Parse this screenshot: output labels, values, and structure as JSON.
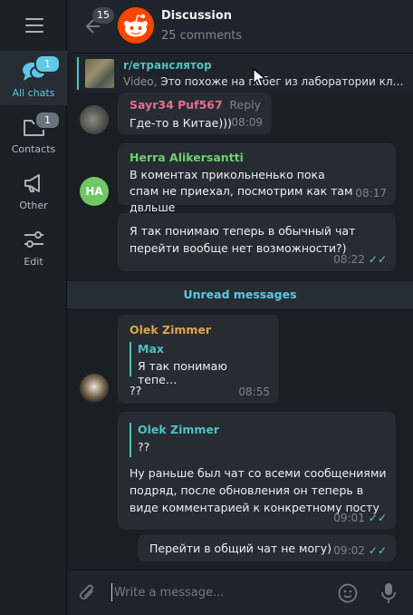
{
  "sidebar": {
    "folders": [
      {
        "label": "All chats",
        "badge": "1",
        "active": true
      },
      {
        "label": "Contacts",
        "badge": "1",
        "active": false
      },
      {
        "label": "Other",
        "badge": "",
        "active": false
      },
      {
        "label": "Edit",
        "badge": "",
        "active": false
      }
    ]
  },
  "header": {
    "back_badge": "15",
    "title": "Discussion",
    "subtitle": "25 comments"
  },
  "pinned": {
    "title": "r/етранслятор",
    "kind": "Video, ",
    "text": "Это похоже на побег из лаборатории кл…"
  },
  "messages": [
    {
      "name": "Sayr34 Puf567",
      "name_color": "#e56e8a",
      "reply_label": "Reply",
      "text": "Где-то в Китае)))",
      "time": "08:09"
    },
    {
      "name": "Herra Alikersantti",
      "name_color": "#6fcf6f",
      "initials": "HA",
      "text": "В коментах прикольненько пока спам не приехал, посмотрим как там двльше",
      "time": "08:17"
    },
    {
      "text": "Я так понимаю теперь в обычный чат перейти вообще нет возможности?)",
      "time": "08:22"
    },
    {
      "name": "Olek Zimmer",
      "name_color": "#e0a44e",
      "quote_name": "Max",
      "quote_text": "Я так понимаю тепе…",
      "text": "??",
      "time": "08:55"
    },
    {
      "quote_name": "Olek Zimmer",
      "quote_text": "??",
      "text": "Ну раньше был чат со всеми сообщениями подряд, после обновления он теперь в виде комментарией к конкретному посту",
      "time": "09:01"
    },
    {
      "text": "Перейти в общий чат не могу)",
      "time": "09:02"
    }
  ],
  "unread_label": "Unread messages",
  "composer": {
    "placeholder": "Write a message..."
  },
  "colors": {
    "accent": "#5ec8e6",
    "reddit": "#ff4500",
    "badge": "#4f8fbf"
  }
}
